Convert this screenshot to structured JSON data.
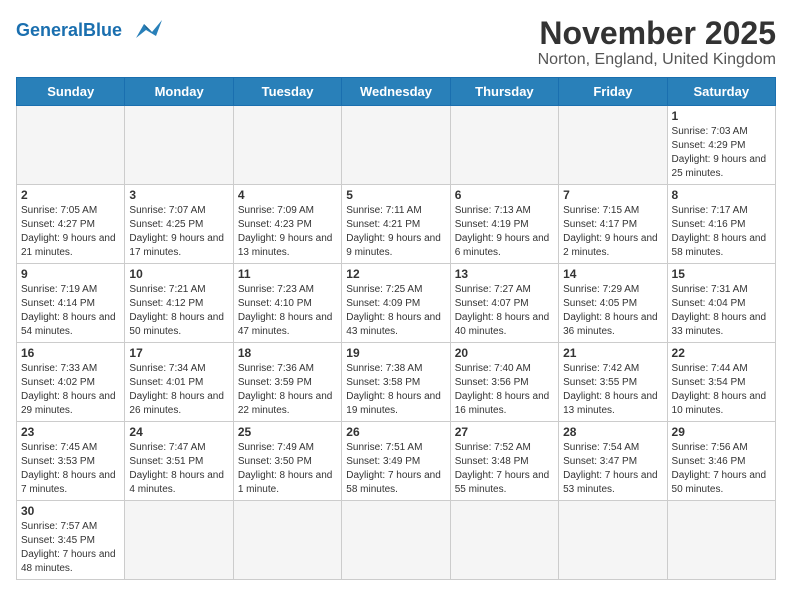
{
  "logo": {
    "general": "General",
    "blue": "Blue"
  },
  "title": "November 2025",
  "subtitle": "Norton, England, United Kingdom",
  "days_of_week": [
    "Sunday",
    "Monday",
    "Tuesday",
    "Wednesday",
    "Thursday",
    "Friday",
    "Saturday"
  ],
  "weeks": [
    [
      {
        "day": "",
        "empty": true
      },
      {
        "day": "",
        "empty": true
      },
      {
        "day": "",
        "empty": true
      },
      {
        "day": "",
        "empty": true
      },
      {
        "day": "",
        "empty": true
      },
      {
        "day": "",
        "empty": true
      },
      {
        "day": "1",
        "info": "Sunrise: 7:03 AM\nSunset: 4:29 PM\nDaylight: 9 hours\nand 25 minutes."
      }
    ],
    [
      {
        "day": "2",
        "info": "Sunrise: 7:05 AM\nSunset: 4:27 PM\nDaylight: 9 hours\nand 21 minutes."
      },
      {
        "day": "3",
        "info": "Sunrise: 7:07 AM\nSunset: 4:25 PM\nDaylight: 9 hours\nand 17 minutes."
      },
      {
        "day": "4",
        "info": "Sunrise: 7:09 AM\nSunset: 4:23 PM\nDaylight: 9 hours\nand 13 minutes."
      },
      {
        "day": "5",
        "info": "Sunrise: 7:11 AM\nSunset: 4:21 PM\nDaylight: 9 hours\nand 9 minutes."
      },
      {
        "day": "6",
        "info": "Sunrise: 7:13 AM\nSunset: 4:19 PM\nDaylight: 9 hours\nand 6 minutes."
      },
      {
        "day": "7",
        "info": "Sunrise: 7:15 AM\nSunset: 4:17 PM\nDaylight: 9 hours\nand 2 minutes."
      },
      {
        "day": "8",
        "info": "Sunrise: 7:17 AM\nSunset: 4:16 PM\nDaylight: 8 hours\nand 58 minutes."
      }
    ],
    [
      {
        "day": "9",
        "info": "Sunrise: 7:19 AM\nSunset: 4:14 PM\nDaylight: 8 hours\nand 54 minutes."
      },
      {
        "day": "10",
        "info": "Sunrise: 7:21 AM\nSunset: 4:12 PM\nDaylight: 8 hours\nand 50 minutes."
      },
      {
        "day": "11",
        "info": "Sunrise: 7:23 AM\nSunset: 4:10 PM\nDaylight: 8 hours\nand 47 minutes."
      },
      {
        "day": "12",
        "info": "Sunrise: 7:25 AM\nSunset: 4:09 PM\nDaylight: 8 hours\nand 43 minutes."
      },
      {
        "day": "13",
        "info": "Sunrise: 7:27 AM\nSunset: 4:07 PM\nDaylight: 8 hours\nand 40 minutes."
      },
      {
        "day": "14",
        "info": "Sunrise: 7:29 AM\nSunset: 4:05 PM\nDaylight: 8 hours\nand 36 minutes."
      },
      {
        "day": "15",
        "info": "Sunrise: 7:31 AM\nSunset: 4:04 PM\nDaylight: 8 hours\nand 33 minutes."
      }
    ],
    [
      {
        "day": "16",
        "info": "Sunrise: 7:33 AM\nSunset: 4:02 PM\nDaylight: 8 hours\nand 29 minutes."
      },
      {
        "day": "17",
        "info": "Sunrise: 7:34 AM\nSunset: 4:01 PM\nDaylight: 8 hours\nand 26 minutes."
      },
      {
        "day": "18",
        "info": "Sunrise: 7:36 AM\nSunset: 3:59 PM\nDaylight: 8 hours\nand 22 minutes."
      },
      {
        "day": "19",
        "info": "Sunrise: 7:38 AM\nSunset: 3:58 PM\nDaylight: 8 hours\nand 19 minutes."
      },
      {
        "day": "20",
        "info": "Sunrise: 7:40 AM\nSunset: 3:56 PM\nDaylight: 8 hours\nand 16 minutes."
      },
      {
        "day": "21",
        "info": "Sunrise: 7:42 AM\nSunset: 3:55 PM\nDaylight: 8 hours\nand 13 minutes."
      },
      {
        "day": "22",
        "info": "Sunrise: 7:44 AM\nSunset: 3:54 PM\nDaylight: 8 hours\nand 10 minutes."
      }
    ],
    [
      {
        "day": "23",
        "info": "Sunrise: 7:45 AM\nSunset: 3:53 PM\nDaylight: 8 hours\nand 7 minutes."
      },
      {
        "day": "24",
        "info": "Sunrise: 7:47 AM\nSunset: 3:51 PM\nDaylight: 8 hours\nand 4 minutes."
      },
      {
        "day": "25",
        "info": "Sunrise: 7:49 AM\nSunset: 3:50 PM\nDaylight: 8 hours\nand 1 minute."
      },
      {
        "day": "26",
        "info": "Sunrise: 7:51 AM\nSunset: 3:49 PM\nDaylight: 7 hours\nand 58 minutes."
      },
      {
        "day": "27",
        "info": "Sunrise: 7:52 AM\nSunset: 3:48 PM\nDaylight: 7 hours\nand 55 minutes."
      },
      {
        "day": "28",
        "info": "Sunrise: 7:54 AM\nSunset: 3:47 PM\nDaylight: 7 hours\nand 53 minutes."
      },
      {
        "day": "29",
        "info": "Sunrise: 7:56 AM\nSunset: 3:46 PM\nDaylight: 7 hours\nand 50 minutes."
      }
    ],
    [
      {
        "day": "30",
        "info": "Sunrise: 7:57 AM\nSunset: 3:45 PM\nDaylight: 7 hours\nand 48 minutes."
      },
      {
        "day": "",
        "empty": true
      },
      {
        "day": "",
        "empty": true
      },
      {
        "day": "",
        "empty": true
      },
      {
        "day": "",
        "empty": true
      },
      {
        "day": "",
        "empty": true
      },
      {
        "day": "",
        "empty": true
      }
    ]
  ]
}
